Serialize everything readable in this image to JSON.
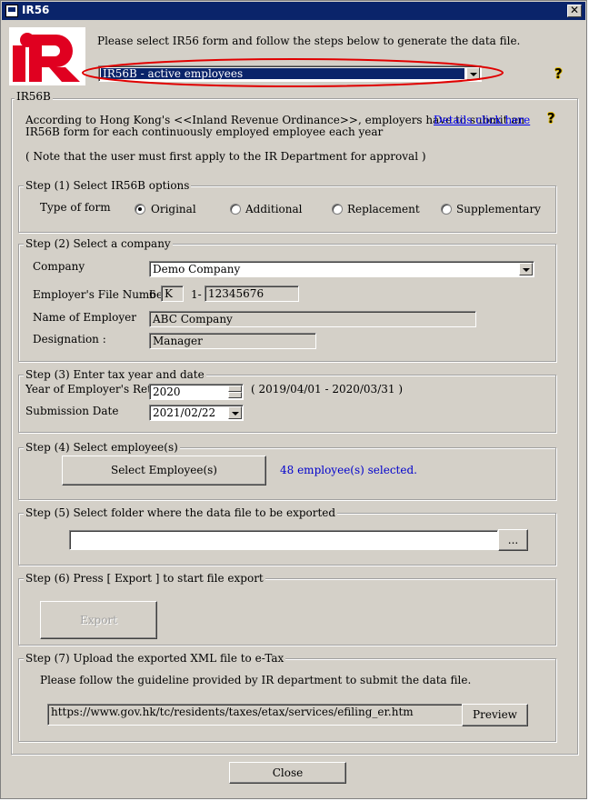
{
  "window": {
    "title": "IR56"
  },
  "header": {
    "instruction": "Please select IR56 form and follow the steps below to generate the data file.",
    "form_select": "IR56B - active employees"
  },
  "ir56b": {
    "group_label": "IR56B",
    "intro_line1": "According to Hong Kong's <<Inland Revenue Ordinance>>, employers have to submit an",
    "intro_line2": "IR56B form for each continuously employed employee each year",
    "details_link": "Details click here",
    "note": "( Note that the user must first apply to the IR Department for approval )"
  },
  "step1": {
    "legend": "Step (1) Select IR56B options",
    "type_label": "Type of form",
    "options": [
      "Original",
      "Additional",
      "Replacement",
      "Supplementary"
    ],
    "selected": "Original"
  },
  "step2": {
    "legend": "Step (2) Select a company",
    "company_label": "Company",
    "company_value": "Demo Company",
    "file_number_label": "Employer's File Number:",
    "file_prefix": "6",
    "file_letter": "K",
    "file_dash": "1-",
    "file_number": "12345676",
    "employer_name_label": "Name of Employer",
    "employer_name": "ABC Company",
    "designation_label": "Designation :",
    "designation": "Manager"
  },
  "step3": {
    "legend": "Step (3) Enter tax year and date",
    "year_label": "Year of Employer's Return",
    "year_value": "2020",
    "year_range": "( 2019/04/01 - 2020/03/31 )",
    "submission_label": "Submission Date",
    "submission_value": "2021/02/22"
  },
  "step4": {
    "legend": "Step (4) Select employee(s)",
    "button": "Select Employee(s)",
    "status": "48 employee(s) selected."
  },
  "step5": {
    "legend": "Step (5) Select folder where the data file to be exported",
    "folder_value": "",
    "browse_button": "..."
  },
  "step6": {
    "legend": "Step (6) Press [ Export ] to start file export",
    "export_button": "Export"
  },
  "step7": {
    "legend": "Step (7) Upload the exported XML file to e-Tax",
    "guideline": "Please follow the guideline provided by IR department to submit the data file.",
    "url": "https://www.gov.hk/tc/residents/taxes/etax/services/efiling_er.htm",
    "preview_button": "Preview"
  },
  "footer": {
    "close_button": "Close"
  },
  "colors": {
    "window_bg": "#d4d0c8",
    "titlebar": "#0a246a",
    "link": "#0000ee",
    "highlight_ellipse": "#e00000",
    "selected_item": "#0a246a",
    "logo_red": "#e00020"
  },
  "icons": {
    "system_menu": "window-icon",
    "close": "close-icon",
    "help": "question-mark-icon",
    "logo": "ir-logo"
  }
}
